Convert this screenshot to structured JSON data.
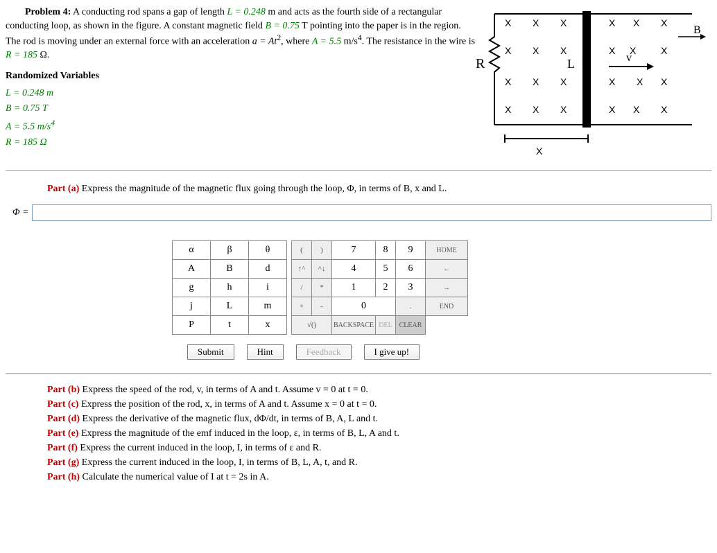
{
  "problem": {
    "label": "Problem 4:",
    "text_before_L": "A conducting rod spans a gap of length ",
    "L_eq": "L = 0.248",
    "text_after_L": " m and acts as the fourth side of a rectangular conducting loop, as shown in the figure. A constant magnetic field ",
    "B_eq": "B = 0.75",
    "text_after_B": " T pointing into the paper is in the region. The rod is moving under an external force with an acceleration ",
    "a_eq": "a = At",
    "a_sup": "2",
    "text_A": ", where ",
    "A_eq": "A = 5.5",
    "A_unit1": " m/s",
    "A_sup": "4",
    "text_resist": ". The resistance in the wire is ",
    "R_eq": "R = 185",
    "R_unit": " Ω."
  },
  "rand_title": "Randomized Variables",
  "vars": {
    "L": "L = 0.248 m",
    "B": "B = 0.75 T",
    "A_pre": "A = 5.5 m/s",
    "A_sup": "4",
    "R": "R = 185 Ω"
  },
  "diagram": {
    "R": "R",
    "L": "L",
    "v": "v",
    "x": "x",
    "B": "B"
  },
  "part_a": {
    "label": "Part (a)",
    "text": " Express the magnitude of the magnetic flux going through the loop, Φ, in terms of B, x and L.",
    "phi": "Φ ="
  },
  "keypad": {
    "sym": [
      [
        "α",
        "β",
        "θ"
      ],
      [
        "A",
        "B",
        "d"
      ],
      [
        "g",
        "h",
        "i"
      ],
      [
        "j",
        "L",
        "m"
      ],
      [
        "P",
        "t",
        "x"
      ]
    ],
    "num": [
      [
        {
          "t": "(",
          "c": "op"
        },
        {
          "t": ")",
          "c": "op"
        },
        {
          "t": "7"
        },
        {
          "t": "8"
        },
        {
          "t": "9"
        },
        {
          "t": "HOME",
          "c": "wide"
        }
      ],
      [
        {
          "t": "↑^",
          "c": "op"
        },
        {
          "t": "^↓",
          "c": "op"
        },
        {
          "t": "4"
        },
        {
          "t": "5"
        },
        {
          "t": "6"
        },
        {
          "t": "←",
          "c": "wide"
        }
      ],
      [
        {
          "t": "/",
          "c": "op"
        },
        {
          "t": "*",
          "c": "op"
        },
        {
          "t": "1"
        },
        {
          "t": "2"
        },
        {
          "t": "3"
        },
        {
          "t": "→",
          "c": "wide"
        }
      ],
      [
        {
          "t": "+",
          "c": "op"
        },
        {
          "t": "-",
          "c": "op"
        },
        {
          "t": "0",
          "s": 2
        },
        {
          "t": ".",
          "c": "op"
        },
        {
          "t": "END",
          "c": "wide"
        }
      ],
      [
        {
          "t": "√()",
          "c": "op",
          "s": 2
        },
        {
          "t": "BACKSPACE",
          "c": "bk"
        },
        {
          "t": "DEL",
          "c": "del"
        },
        {
          "t": "CLEAR",
          "c": "clr"
        }
      ]
    ]
  },
  "buttons": {
    "submit": "Submit",
    "hint": "Hint",
    "feedback": "Feedback",
    "giveup": "I give up!"
  },
  "parts": {
    "b": {
      "label": "Part (b)",
      "text": " Express the speed of the rod, v, in terms of A and t. Assume v = 0 at t = 0."
    },
    "c": {
      "label": "Part (c)",
      "text": " Express the position of the rod, x, in terms of A and t. Assume x = 0 at t = 0."
    },
    "d": {
      "label": "Part (d)",
      "text": " Express the derivative of the magnetic flux, dΦ/dt, in terms of B, A, L and t."
    },
    "e": {
      "label": "Part (e)",
      "text": " Express the magnitude of the emf induced in the loop, ε, in terms of B, L, A and t."
    },
    "f": {
      "label": "Part (f)",
      "text": " Express the current induced in the loop, I, in terms of ε and R."
    },
    "g": {
      "label": "Part (g)",
      "text": " Express the current induced in the loop, I, in terms of B, L, A, t, and R."
    },
    "h": {
      "label": "Part (h)",
      "text": " Calculate the numerical value of I at t = 2s in A."
    }
  }
}
